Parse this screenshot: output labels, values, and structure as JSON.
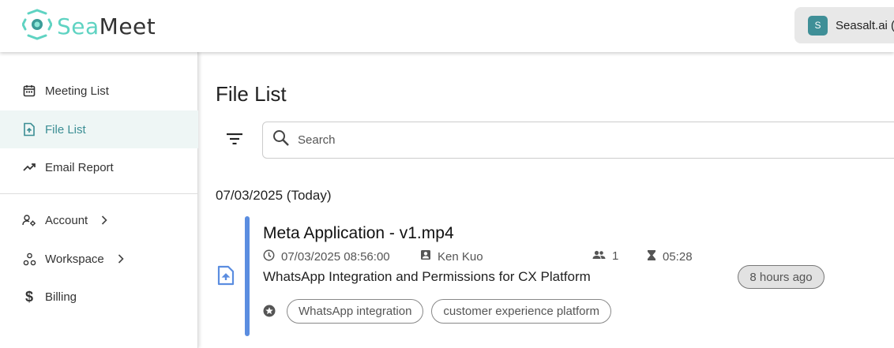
{
  "brand": {
    "logo_sea": "Sea",
    "logo_meet": "Meet",
    "accent": "#5fd3c2"
  },
  "header": {
    "org_initial": "S",
    "org_name": "Seasalt.ai ("
  },
  "sidebar": {
    "items": [
      {
        "label": "Meeting List",
        "icon": "calendar-icon"
      },
      {
        "label": "File List",
        "icon": "file-upload-icon",
        "active": true
      },
      {
        "label": "Email Report",
        "icon": "trending-up-icon"
      },
      {
        "label": "Account",
        "icon": "account-settings-icon",
        "has_submenu": true
      },
      {
        "label": "Workspace",
        "icon": "workspace-icon",
        "has_submenu": true
      },
      {
        "label": "Billing",
        "icon": "dollar-icon"
      }
    ],
    "active_color": "#3b8e94"
  },
  "main": {
    "title": "File List",
    "search": {
      "placeholder": "Search",
      "value": ""
    },
    "date_group": "07/03/2025 (Today)",
    "files": [
      {
        "title": "Meta Application - v1.mp4",
        "datetime": "07/03/2025 08:56:00",
        "owner": "Ken Kuo",
        "participants": "1",
        "duration": "05:28",
        "subject": "WhatsApp Integration and Permissions for CX Platform",
        "relative_time": "8 hours ago",
        "tags": [
          "WhatsApp integration",
          "customer experience platform"
        ],
        "accent": "#5b8de0"
      }
    ]
  }
}
